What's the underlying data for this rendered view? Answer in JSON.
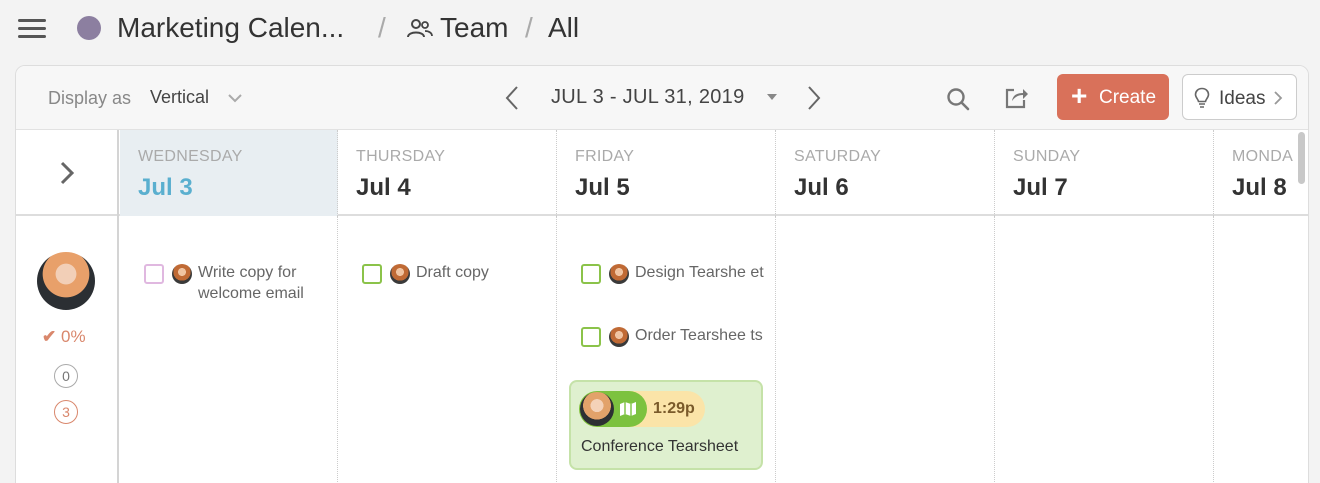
{
  "breadcrumb": {
    "calendar": "Marketing Calen...",
    "team": "Team",
    "filter": "All",
    "separator": "/"
  },
  "toolbar": {
    "display_label": "Display as",
    "display_value": "Vertical",
    "date_range": "JUL 3 - JUL 31, 2019",
    "create_label": "Create",
    "ideas_label": "Ideas"
  },
  "days": [
    {
      "dow": "WEDNESDAY",
      "date": "Jul 3"
    },
    {
      "dow": "THURSDAY",
      "date": "Jul 4"
    },
    {
      "dow": "FRIDAY",
      "date": "Jul 5"
    },
    {
      "dow": "SATURDAY",
      "date": "Jul 6"
    },
    {
      "dow": "SUNDAY",
      "date": "Jul 7"
    },
    {
      "dow": "MONDA",
      "date": "Jul 8"
    }
  ],
  "user": {
    "completion": "0%",
    "count_a": "0",
    "count_b": "3"
  },
  "tasks": {
    "jul3": [
      "Write copy for welcome email"
    ],
    "jul4": [
      "Draft copy"
    ],
    "jul5": [
      "Design Tearshe et",
      "Order Tearshee ts"
    ]
  },
  "event": {
    "time": "1:29p",
    "title": "Conference Tearsheet"
  },
  "colors": {
    "accent": "#d9715a",
    "today": "#5aafcf",
    "event_bg": "#dff0cf",
    "task_check": "#8bc34a"
  },
  "icons": {
    "menu": "hamburger-icon",
    "calendar_dot": "calendar-color-dot",
    "team": "team-icon",
    "search": "search-icon",
    "share": "share-icon",
    "ideas": "lightbulb-icon",
    "event": "map-icon"
  }
}
